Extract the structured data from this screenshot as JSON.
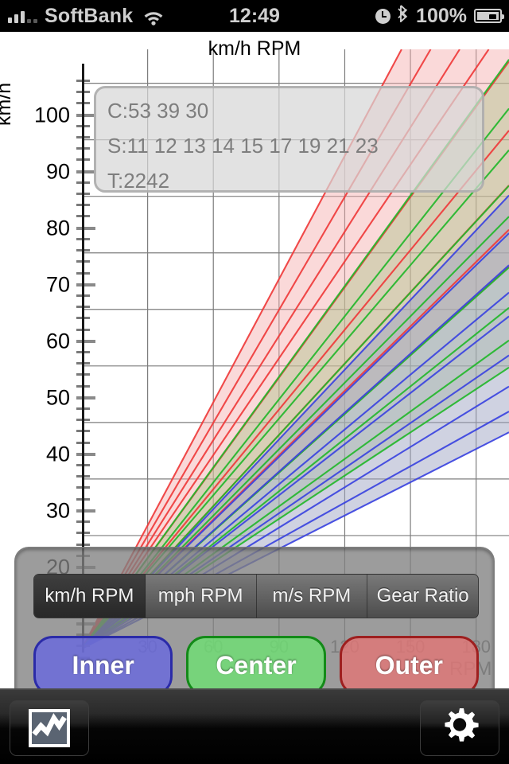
{
  "statusbar": {
    "carrier": "SoftBank",
    "time": "12:49",
    "battery": "100%",
    "icons": {
      "signal": "signal-bars-icon",
      "wifi": "wifi-icon",
      "clock": "alarm-clock-icon",
      "bluetooth": "bluetooth-icon",
      "battery": "battery-icon"
    }
  },
  "chart_data": {
    "type": "line",
    "title": "km/h RPM",
    "xlabel": "RPM",
    "ylabel": "km/h",
    "xlim": [
      0,
      195
    ],
    "ylim": [
      0,
      106
    ],
    "xticks": [
      30,
      60,
      90,
      120,
      150,
      180
    ],
    "yticks": [
      20,
      30,
      40,
      50,
      60,
      70,
      80,
      90,
      100
    ],
    "grid": true,
    "legend_position": "bottom-overlay",
    "x_minor_per_major": 3,
    "y_minor_per_major": 4,
    "annotation": {
      "chainrings_label": "C:53 39 30",
      "sprockets_label": "S:11 12 13 14 15 17 19 21 23",
      "tire_label": "T:2242",
      "chainrings": [
        53,
        39,
        30
      ],
      "sprockets": [
        11,
        12,
        13,
        14,
        15,
        17,
        19,
        21,
        23
      ],
      "tire_circumference_mm": 2242
    },
    "series": [
      {
        "name": "Outer",
        "color": "#ef3b3b",
        "fill": "rgba(244,170,170,0.45)",
        "chainring": 53,
        "slopes_kmh_per_rpm": [
          0.7263,
          0.6658,
          0.6146,
          0.5707,
          0.5326,
          0.47,
          0.4203,
          0.38,
          0.3466
        ]
      },
      {
        "name": "Center",
        "color": "#23b72b",
        "fill": "rgba(176,196,140,0.45)",
        "chainring": 39,
        "slopes_kmh_per_rpm": [
          0.5344,
          0.4899,
          0.4522,
          0.4199,
          0.3919,
          0.3458,
          0.3092,
          0.2796,
          0.255
        ]
      },
      {
        "name": "Inner",
        "color": "#3b43e0",
        "fill": "rgba(160,165,195,0.50)",
        "chainring": 30,
        "slopes_kmh_per_rpm": [
          0.4111,
          0.3768,
          0.3478,
          0.323,
          0.3014,
          0.266,
          0.2378,
          0.2151,
          0.1962
        ]
      }
    ]
  },
  "panel": {
    "segments": [
      {
        "label": "km/h RPM",
        "selected": true
      },
      {
        "label": "mph RPM",
        "selected": false
      },
      {
        "label": "m/s RPM",
        "selected": false
      },
      {
        "label": "Gear Ratio",
        "selected": false
      }
    ],
    "mode_buttons": [
      {
        "label": "Inner",
        "color": "#6868e0"
      },
      {
        "label": "Center",
        "color": "#6ee173"
      },
      {
        "label": "Outer",
        "color": "#e27676"
      }
    ]
  },
  "toolbar": {
    "chart_button": "chart-icon",
    "settings_button": "gear-icon"
  }
}
